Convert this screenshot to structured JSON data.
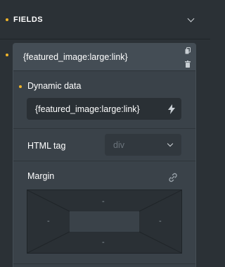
{
  "section": {
    "title": "FIELDS"
  },
  "item": {
    "title": "{featured_image:large:link}"
  },
  "dynamic_data": {
    "label": "Dynamic data",
    "value": "{featured_image:large:link}"
  },
  "html_tag": {
    "label": "HTML tag",
    "value": "div"
  },
  "margin": {
    "label": "Margin",
    "top": "-",
    "right": "-",
    "bottom": "-",
    "left": "-"
  },
  "colors": {
    "accent": "#f0b429",
    "panel": "#3a4249",
    "input": "#2a3035"
  },
  "icons": [
    "chevron-down-icon",
    "copy-icon",
    "trash-icon",
    "bolt-icon",
    "link-icon"
  ]
}
